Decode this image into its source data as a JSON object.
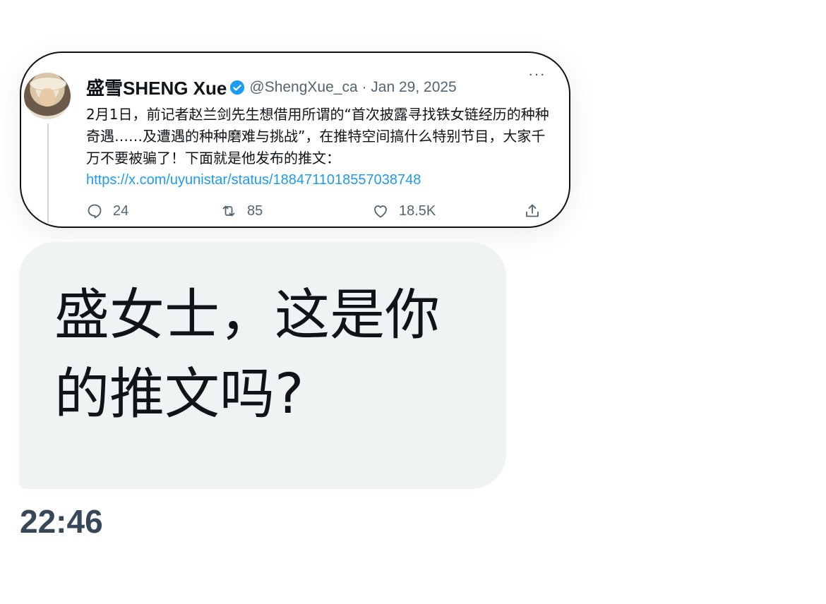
{
  "tweet": {
    "display_name": "盛雪SHENG Xue",
    "handle_date": "@ShengXue_ca · Jan 29, 2025",
    "more": "···",
    "body_text": "2月1日，前记者赵兰剑先生想借用所谓的“首次披露寻找铁女链经历的种种奇遇……及遭遇的种种磨难与挑战”，在推特空间搞什么特别节目，大家千万不要被骗了！下面就是他发布的推文：",
    "link": "https://x.com/uyunistar/status/1884711018557038748",
    "replies": "24",
    "retweets": "85",
    "likes": "18.5K",
    "icons": {
      "verified": "verified-badge-icon",
      "reply": "reply-icon",
      "retweet": "retweet-icon",
      "like": "heart-icon",
      "share": "share-icon"
    },
    "accent_color": "#1d9bf0"
  },
  "message": {
    "text": "盛女士，这是你的推文吗?",
    "time": "22:46",
    "bubble_color": "#eff3f4"
  }
}
